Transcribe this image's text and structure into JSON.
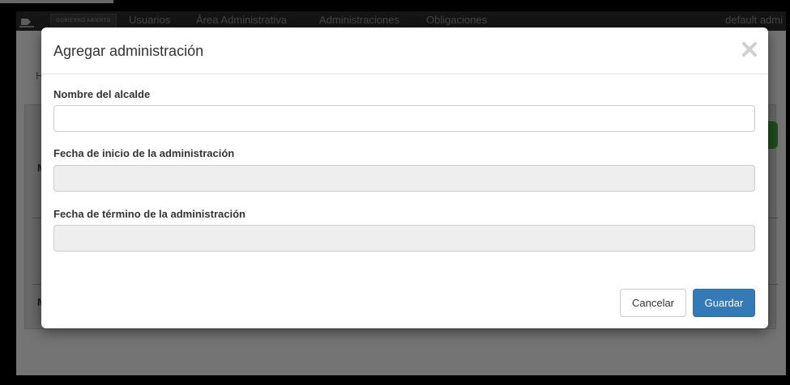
{
  "navbar": {
    "brand": "GOBIERNO ABIERTO",
    "links": [
      "Usuarios",
      "Área Administrativa",
      "Administraciones",
      "Obligaciones"
    ],
    "user": "default admi"
  },
  "modal": {
    "title": "Agregar administración",
    "fields": [
      {
        "label": "Nombre del alcalde",
        "value": "",
        "placeholder": ""
      },
      {
        "label": "Fecha de inicio de la administración",
        "value": "",
        "placeholder": ""
      },
      {
        "label": "Fecha de término de la administración",
        "value": "",
        "placeholder": ""
      }
    ],
    "cancel_label": "Cancelar",
    "save_label": "Guardar"
  },
  "background": {
    "letters": [
      "H",
      "M",
      "M"
    ]
  },
  "colors": {
    "primary": "#337ab7",
    "navbar": "#2a2a2a",
    "backdrop": "rgba(0,0,0,0.5)"
  },
  "icons": {
    "close": "close-icon",
    "logo": "logo-icon"
  }
}
